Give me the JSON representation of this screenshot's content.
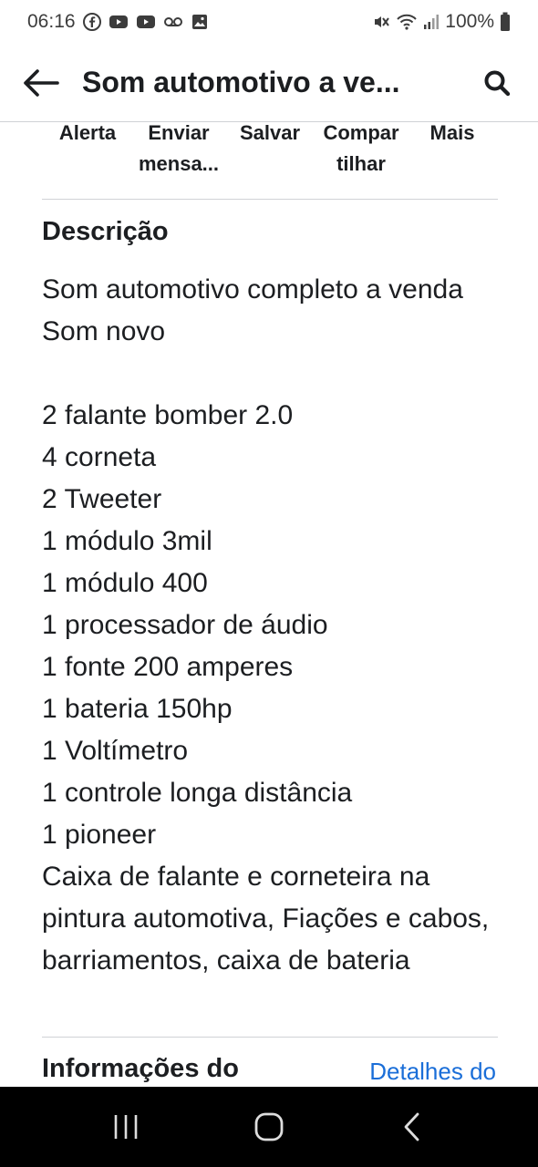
{
  "status_bar": {
    "time": "06:16",
    "battery": "100%",
    "icons_left": [
      "facebook-icon",
      "youtube-icon",
      "youtube-icon",
      "voicemail-icon",
      "gallery-icon"
    ],
    "icons_right": [
      "mute-icon",
      "wifi-icon",
      "signal-icon",
      "battery-icon"
    ]
  },
  "header": {
    "title": "Som automotivo a ve..."
  },
  "actions": [
    {
      "label": "Alerta"
    },
    {
      "label": "Enviar mensa..."
    },
    {
      "label": "Salvar"
    },
    {
      "label": "Compar tilhar"
    },
    {
      "label": "Mais"
    }
  ],
  "description": {
    "title": "Descrição",
    "intro": "Som automotivo completo a venda Som novo",
    "lines": [
      "2 falante bomber 2.0",
      "4 corneta",
      "2 Tweeter",
      "1 módulo 3mil",
      "1 módulo 400",
      "1 processador de áudio",
      "1 fonte 200 amperes",
      "1 bateria 150hp",
      "1 Voltímetro",
      "1 controle longa distância",
      "1 pioneer"
    ],
    "outro": "Caixa de falante e corneteira na pintura automotiva, Fiações e cabos, barriamentos, caixa de bateria"
  },
  "info": {
    "title": "Informações do",
    "link": "Detalhes do"
  },
  "colors": {
    "link": "#1a6ed8",
    "text": "#1c1e21",
    "divider": "#d0d2d6",
    "navbar": "#000000"
  }
}
